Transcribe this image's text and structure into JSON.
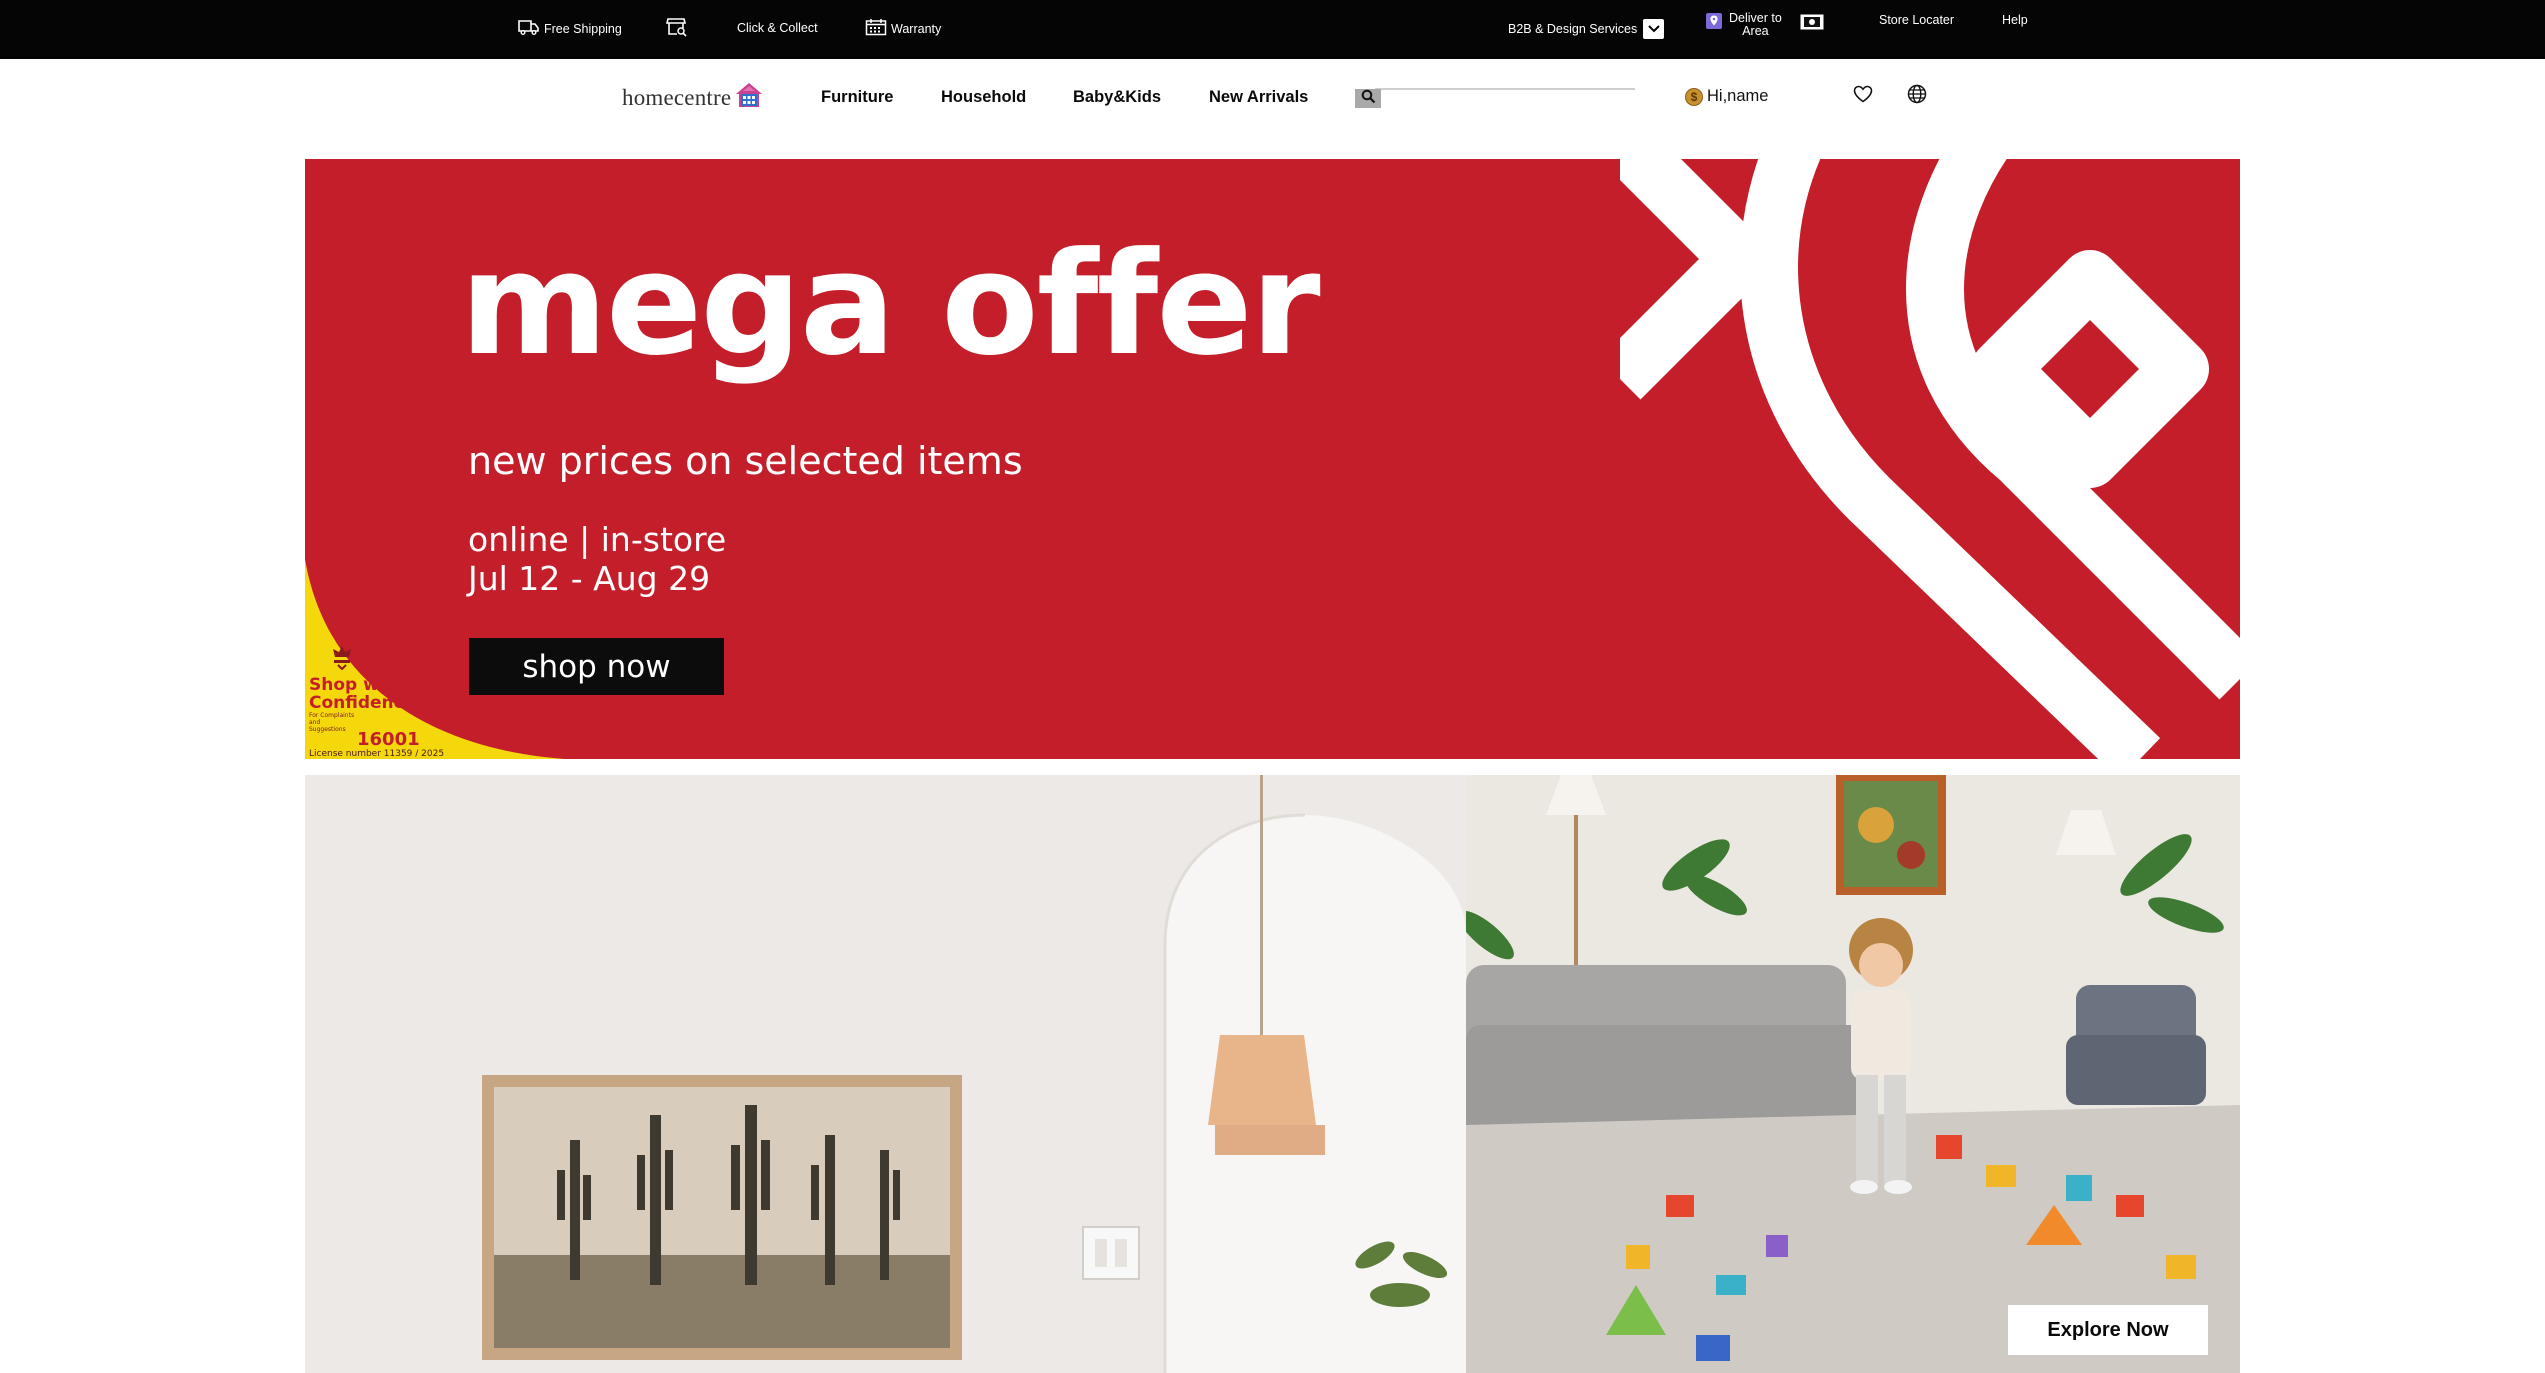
{
  "topbar": {
    "free_shipping": "Free Shipping",
    "click_collect": "Click & Collect",
    "warranty": "Warranty",
    "b2b": "B2B & Design Services",
    "deliver_line1": "Deliver to",
    "deliver_line2": "Area",
    "store_locator": "Store Locater",
    "help": "Help"
  },
  "header": {
    "logo_text": "homecentre",
    "nav": [
      "Furniture",
      "Household",
      "Baby&Kids",
      "New Arrivals"
    ],
    "search_placeholder": "",
    "greeting": "Hi,name",
    "coin_symbol": "$"
  },
  "hero": {
    "title": "mega offer",
    "subtitle": "new prices on selected items",
    "channels": "online | in-store",
    "dates": "Jul 12 - Aug 29",
    "cta": "shop now",
    "badge": {
      "line1": "Shop with",
      "line2": "Confidence",
      "small": "For Complaints and Suggestions",
      "number": "16001",
      "license": "License number    11359 / 2025"
    }
  },
  "tiles": {
    "explore_cta": "Explore Now"
  },
  "colors": {
    "topbar_bg": "#050505",
    "hero_red": "#c41e2a",
    "hero_yellow": "#f5d80c",
    "cta_black": "#0c0c0c"
  },
  "icons": [
    "truck-icon",
    "store-icon",
    "calendar-icon",
    "chevron-down-icon",
    "location-pin-icon",
    "flag-icon",
    "search-icon",
    "coin-icon",
    "heart-icon",
    "globe-icon"
  ]
}
